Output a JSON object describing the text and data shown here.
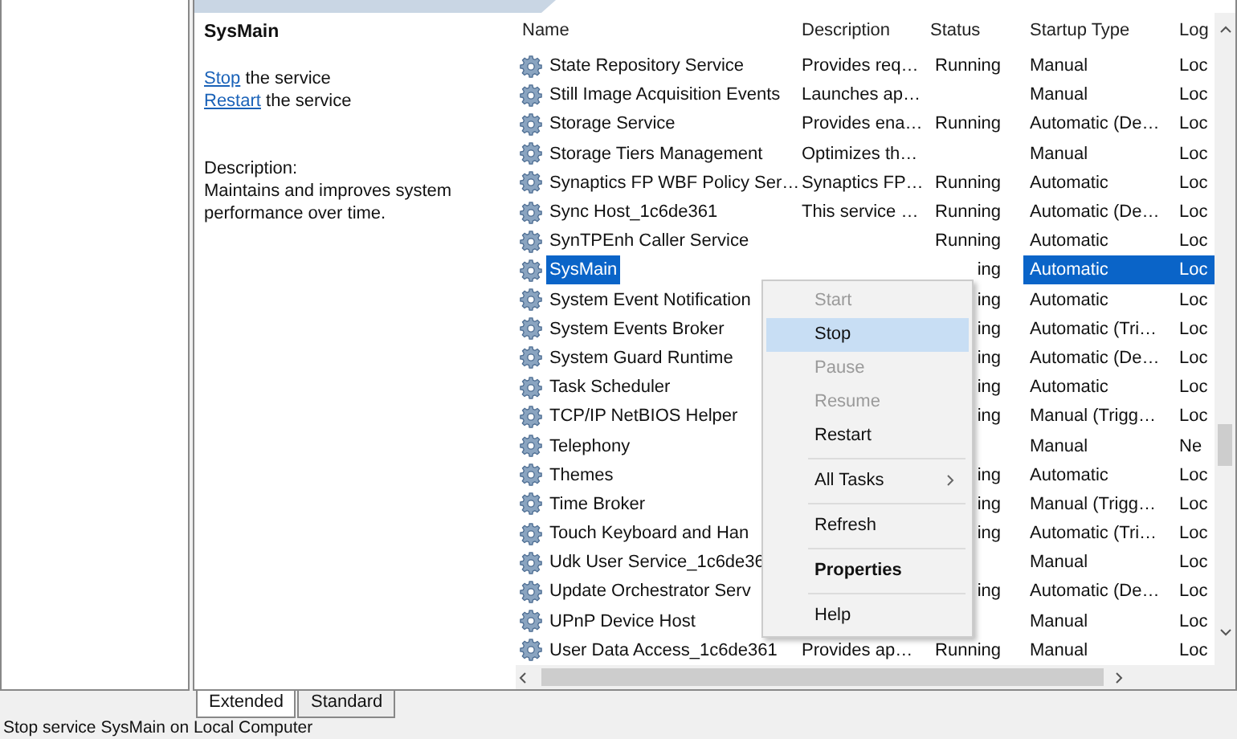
{
  "details": {
    "service_name": "SysMain",
    "actions": [
      {
        "link": "Stop",
        "rest": " the service"
      },
      {
        "link": "Restart",
        "rest": " the service"
      }
    ],
    "description_label": "Description:",
    "description": "Maintains and improves system performance over time."
  },
  "table": {
    "columns": [
      "Name",
      "Description",
      "Status",
      "Startup Type",
      "Log"
    ],
    "rows": [
      {
        "name": "State Repository Service",
        "description": "Provides req…",
        "status": "Running",
        "startup_type": "Manual",
        "log_on": "Loc",
        "selected": false
      },
      {
        "name": "Still Image Acquisition Events",
        "description": "Launches ap…",
        "status": "",
        "startup_type": "Manual",
        "log_on": "Loc",
        "selected": false
      },
      {
        "name": "Storage Service",
        "description": "Provides ena…",
        "status": "Running",
        "startup_type": "Automatic (De…",
        "log_on": "Loc",
        "selected": false
      },
      {
        "name": "Storage Tiers Management",
        "description": "Optimizes th…",
        "status": "",
        "startup_type": "Manual",
        "log_on": "Loc",
        "selected": false
      },
      {
        "name": "Synaptics FP WBF Policy Ser…",
        "description": "Synaptics FP…",
        "status": "Running",
        "startup_type": "Automatic",
        "log_on": "Loc",
        "selected": false
      },
      {
        "name": "Sync Host_1c6de361",
        "description": "This service …",
        "status": "Running",
        "startup_type": "Automatic (De…",
        "log_on": "Loc",
        "selected": false
      },
      {
        "name": "SynTPEnh Caller Service",
        "description": "",
        "status": "Running",
        "startup_type": "Automatic",
        "log_on": "Loc",
        "selected": false
      },
      {
        "name": "SysMain",
        "description": "",
        "status": "ing",
        "startup_type": "Automatic",
        "log_on": "Loc",
        "selected": true
      },
      {
        "name": "System Event Notification",
        "description": "",
        "status": "ing",
        "startup_type": "Automatic",
        "log_on": "Loc",
        "selected": false
      },
      {
        "name": "System Events Broker",
        "description": "",
        "status": "ing",
        "startup_type": "Automatic (Tri…",
        "log_on": "Loc",
        "selected": false
      },
      {
        "name": "System Guard Runtime",
        "description": "",
        "status": "ing",
        "startup_type": "Automatic (De…",
        "log_on": "Loc",
        "selected": false
      },
      {
        "name": "Task Scheduler",
        "description": "",
        "status": "ing",
        "startup_type": "Automatic",
        "log_on": "Loc",
        "selected": false
      },
      {
        "name": "TCP/IP NetBIOS Helper",
        "description": "",
        "status": "ing",
        "startup_type": "Manual (Trigg…",
        "log_on": "Loc",
        "selected": false
      },
      {
        "name": "Telephony",
        "description": "",
        "status": "",
        "startup_type": "Manual",
        "log_on": "Ne",
        "selected": false
      },
      {
        "name": "Themes",
        "description": "",
        "status": "ing",
        "startup_type": "Automatic",
        "log_on": "Loc",
        "selected": false
      },
      {
        "name": "Time Broker",
        "description": "",
        "status": "ing",
        "startup_type": "Manual (Trigg…",
        "log_on": "Loc",
        "selected": false
      },
      {
        "name": "Touch Keyboard and Han",
        "description": "",
        "status": "ing",
        "startup_type": "Automatic (Tri…",
        "log_on": "Loc",
        "selected": false
      },
      {
        "name": "Udk User Service_1c6de36",
        "description": "",
        "status": "",
        "startup_type": "Manual",
        "log_on": "Loc",
        "selected": false
      },
      {
        "name": "Update Orchestrator Serv",
        "description": "",
        "status": "ing",
        "startup_type": "Automatic (De…",
        "log_on": "Loc",
        "selected": false
      },
      {
        "name": "UPnP Device Host",
        "description": "",
        "status": "",
        "startup_type": "Manual",
        "log_on": "Loc",
        "selected": false
      },
      {
        "name": "User Data Access_1c6de361",
        "description": "Provides ap…",
        "status": "Running",
        "startup_type": "Manual",
        "log_on": "Loc",
        "selected": false
      }
    ]
  },
  "context_menu": [
    {
      "kind": "item",
      "label": "Start",
      "disabled": true,
      "selected": false,
      "bold": false,
      "submenu": false
    },
    {
      "kind": "item",
      "label": "Stop",
      "disabled": false,
      "selected": true,
      "bold": false,
      "submenu": false
    },
    {
      "kind": "item",
      "label": "Pause",
      "disabled": true,
      "selected": false,
      "bold": false,
      "submenu": false
    },
    {
      "kind": "item",
      "label": "Resume",
      "disabled": true,
      "selected": false,
      "bold": false,
      "submenu": false
    },
    {
      "kind": "item",
      "label": "Restart",
      "disabled": false,
      "selected": false,
      "bold": false,
      "submenu": false
    },
    {
      "kind": "separator"
    },
    {
      "kind": "item",
      "label": "All Tasks",
      "disabled": false,
      "selected": false,
      "bold": false,
      "submenu": true
    },
    {
      "kind": "separator"
    },
    {
      "kind": "item",
      "label": "Refresh",
      "disabled": false,
      "selected": false,
      "bold": false,
      "submenu": false
    },
    {
      "kind": "separator"
    },
    {
      "kind": "item",
      "label": "Properties",
      "disabled": false,
      "selected": false,
      "bold": true,
      "submenu": false
    },
    {
      "kind": "separator"
    },
    {
      "kind": "item",
      "label": "Help",
      "disabled": false,
      "selected": false,
      "bold": false,
      "submenu": false
    }
  ],
  "view_tabs": [
    {
      "label": "Extended",
      "selected": true
    },
    {
      "label": "Standard",
      "selected": false
    }
  ],
  "status_bar": "Stop service SysMain on Local Computer"
}
